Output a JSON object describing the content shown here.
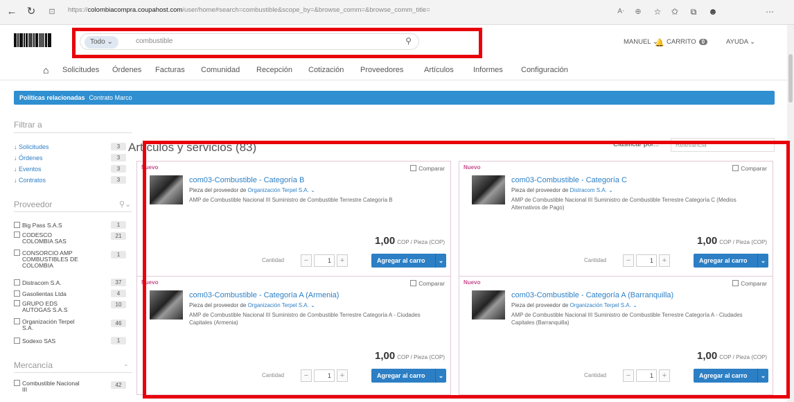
{
  "browser": {
    "url_prefix": "https://",
    "url_host": "colombiacompra.coupahost.com",
    "url_path": "/user/home#search=combustible&scope_by=&browse_comm=&browse_comm_title=",
    "icons": [
      "back-icon",
      "refresh-icon",
      "lock-icon",
      "read-aloud-icon",
      "zoom-icon",
      "favorite-icon",
      "collections-icon",
      "profile-icon",
      "more-icon"
    ]
  },
  "header": {
    "search_scope": "Todo ⌄",
    "search_value": "combustible",
    "user": "MANUEL ⌄",
    "cart_label": "CARRITO",
    "cart_count": "0",
    "help": "AYUDA ⌄"
  },
  "nav": [
    "Solicitudes",
    "Órdenes",
    "Facturas",
    "Comunidad",
    "Recepción",
    "Cotización",
    "Proveedores",
    "Artículos",
    "Informes",
    "Configuración"
  ],
  "banner": {
    "label": "Políticas relacionadas",
    "link": "Contrato Marco"
  },
  "sidebar": {
    "filter_title": "Filtrar a",
    "links": [
      {
        "label": "Solicitudes",
        "count": "3"
      },
      {
        "label": "Órdenes",
        "count": "3"
      },
      {
        "label": "Eventos",
        "count": "3"
      },
      {
        "label": "Contratos",
        "count": "3"
      }
    ],
    "supplier_title": "Proveedor",
    "suppliers": [
      {
        "label": "Big Pass S.A.S",
        "count": "1"
      },
      {
        "label": "CODESCO COLOMBIA SAS",
        "count": "21"
      },
      {
        "label": "CONSORCIO AMP COMBUSTIBLES DE COLOMBIA",
        "count": "1"
      },
      {
        "label": "Distracom S.A.",
        "count": "37"
      },
      {
        "label": "Gasolientas Ltda",
        "count": "4"
      },
      {
        "label": "GRUPO EDS AUTOGAS S.A.S",
        "count": "10"
      },
      {
        "label": "Organización Terpel S.A.",
        "count": "46"
      },
      {
        "label": "Sodexo SAS",
        "count": "1"
      }
    ],
    "commodity_title": "Mercancía",
    "commodities": [
      {
        "label": "Combustible Nacional III",
        "count": "42"
      }
    ]
  },
  "main": {
    "heading": "Artículos y servicios (83)",
    "sort_label": "Clasificar por...",
    "sort_value": "Relevancia",
    "cards": [
      {
        "badge": "Nuevo",
        "compare": "Comparar",
        "title": "com03-Combustible - Categoría B",
        "supplier_prefix": "Pieza del proveedor de",
        "supplier": "Organización Terpel S.A. ⌄",
        "desc": "AMP de Combustible Nacional III Suministro de Combustible Terrestre Categoría B",
        "price": "1,00",
        "price_unit": "COP / Pieza (COP)",
        "qty_label": "Cantidad",
        "qty": "1",
        "add": "Agregar al carro"
      },
      {
        "badge": "Nuevo",
        "compare": "Comparar",
        "title": "com03-Combustible - Categoría C",
        "supplier_prefix": "Pieza del proveedor de",
        "supplier": "Distracom S.A. ⌄",
        "desc": "AMP de Combustible Nacional III Suministro de Combustible Terrestre Categoría C (Medios Alternativos de Pago)",
        "price": "1,00",
        "price_unit": "COP / Pieza (COP)",
        "qty_label": "Cantidad",
        "qty": "1",
        "add": "Agregar al carro"
      },
      {
        "badge": "Nuevo",
        "compare": "Comparar",
        "title": "com03-Combustible - Categoría A (Armenia)",
        "supplier_prefix": "Pieza del proveedor de",
        "supplier": "Organización Terpel S.A. ⌄",
        "desc": "AMP de Combustible Nacional III Suministro de Combustible Terrestre Categoría A - Ciudades Capitales (Armenia)",
        "price": "1,00",
        "price_unit": "COP / Pieza (COP)",
        "qty_label": "Cantidad",
        "qty": "1",
        "add": "Agregar al carro"
      },
      {
        "badge": "Nuevo",
        "compare": "Comparar",
        "title": "com03-Combustible - Categoría A (Barranquilla)",
        "supplier_prefix": "Pieza del proveedor de",
        "supplier": "Organización Terpel S.A. ⌄",
        "desc": "AMP de Combustible Nacional III Suministro de Combustible Terrestre Categoría A - Ciudades Capitales (Barranquilla)",
        "price": "1,00",
        "price_unit": "COP / Pieza (COP)",
        "qty_label": "Cantidad",
        "qty": "1",
        "add": "Agregar al carro"
      }
    ]
  },
  "colors": {
    "highlight": "#e8000b",
    "accent": "#2c7fc4",
    "banner": "#2f8fd1"
  }
}
